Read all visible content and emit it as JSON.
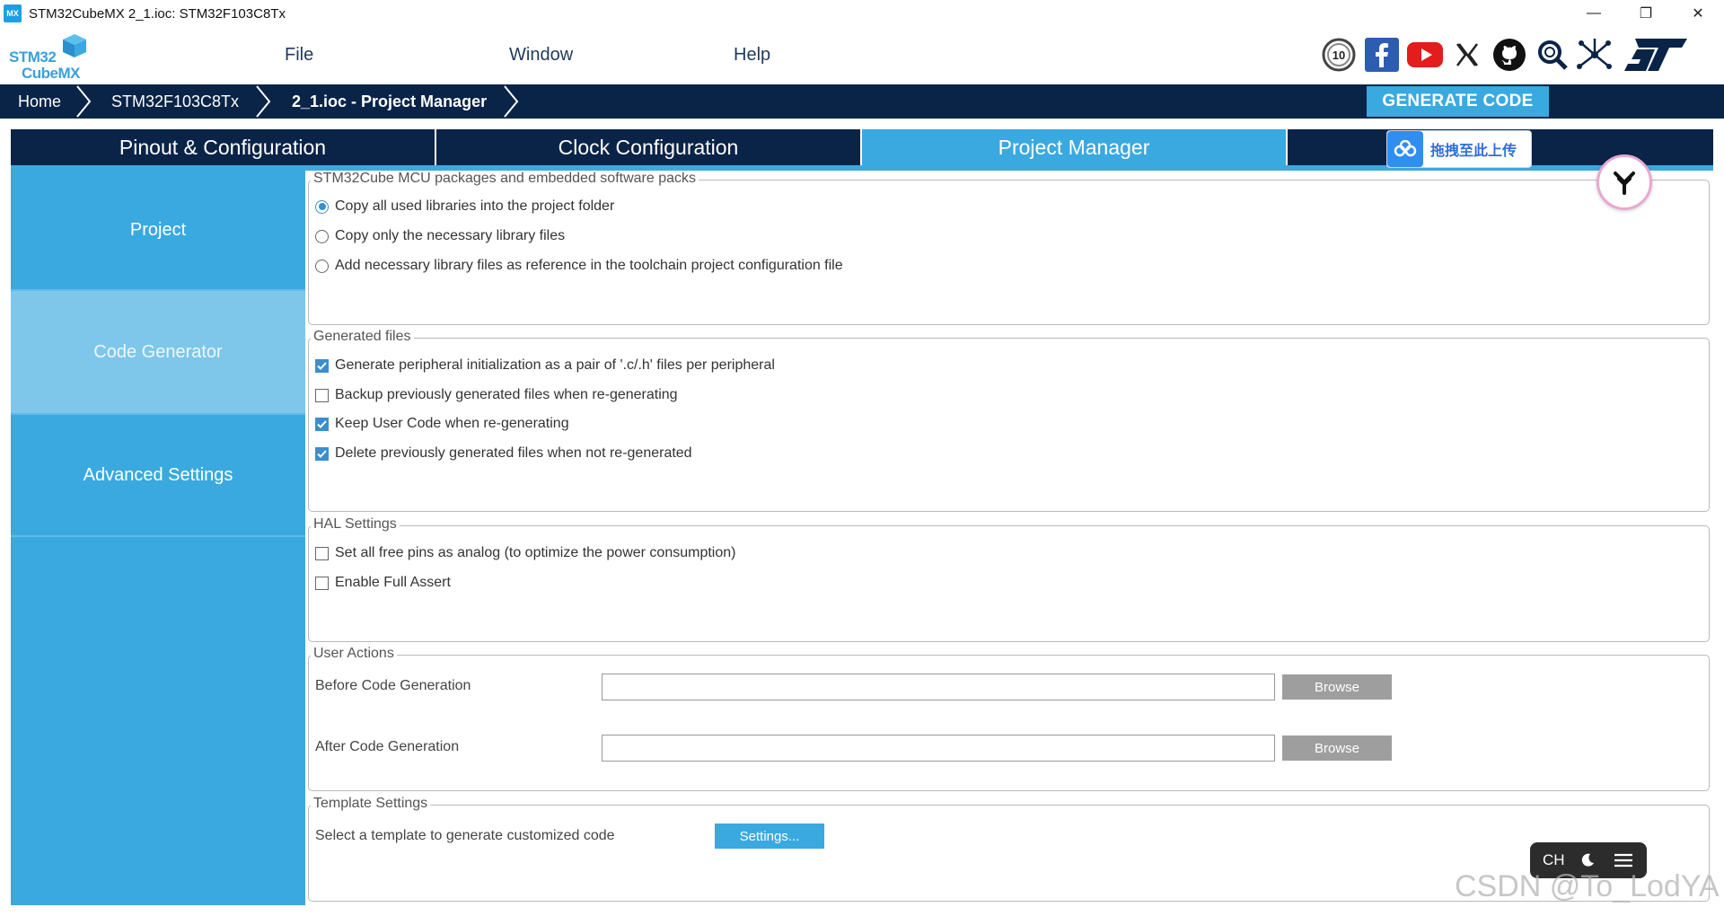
{
  "window": {
    "app_icon_text": "MX",
    "title": "STM32CubeMX 2_1.ioc: STM32F103C8Tx",
    "controls": [
      "—",
      "❐",
      "✕"
    ]
  },
  "logo": {
    "line1": "STM32",
    "line2": "CubeMX"
  },
  "menu": {
    "file": "File",
    "window": "Window",
    "help": "Help"
  },
  "social_icons": [
    "anniversary-10-icon",
    "facebook-icon",
    "youtube-icon",
    "x-icon",
    "github-icon",
    "search-community-icon",
    "network-icon",
    "st-logo-icon"
  ],
  "breadcrumb": {
    "home": "Home",
    "mcu": "STM32F103C8Tx",
    "project": "2_1.ioc - Project Manager"
  },
  "generate_button": "GENERATE CODE",
  "tabs": {
    "pinout": "Pinout & Configuration",
    "clock": "Clock Configuration",
    "project_manager": "Project Manager"
  },
  "upload_chip": "拖拽至此上传",
  "sidebar": {
    "project": "Project",
    "code_generator": "Code Generator",
    "advanced": "Advanced Settings"
  },
  "packages": {
    "title": "STM32Cube MCU packages and embedded software packs",
    "options": [
      "Copy all used libraries into the project folder",
      "Copy only the necessary library files",
      "Add necessary library files as reference in the toolchain project configuration file"
    ],
    "selected": 0
  },
  "generated_files": {
    "title": "Generated files",
    "options": [
      "Generate peripheral initialization as a pair of '.c/.h' files per peripheral",
      "Backup previously generated files when re-generating",
      "Keep User Code when re-generating",
      "Delete previously generated files when not re-generated"
    ],
    "checked": [
      true,
      false,
      true,
      true
    ]
  },
  "hal": {
    "title": "HAL Settings",
    "options": [
      "Set all free pins as analog (to optimize the power consumption)",
      "Enable Full Assert"
    ],
    "checked": [
      false,
      false
    ]
  },
  "user_actions": {
    "title": "User Actions",
    "before_label": "Before Code Generation",
    "after_label": "After Code Generation",
    "before_value": "",
    "after_value": "",
    "browse": "Browse"
  },
  "template": {
    "title": "Template Settings",
    "label": "Select a template to generate customized code",
    "button": "Settings..."
  },
  "ime": {
    "lang": "CH"
  },
  "watermark": "CSDN @To_LodYA",
  "colors": {
    "navy": "#0a2448",
    "accent": "#3aa9e0",
    "sidebar_active": "#7ec6ea"
  }
}
